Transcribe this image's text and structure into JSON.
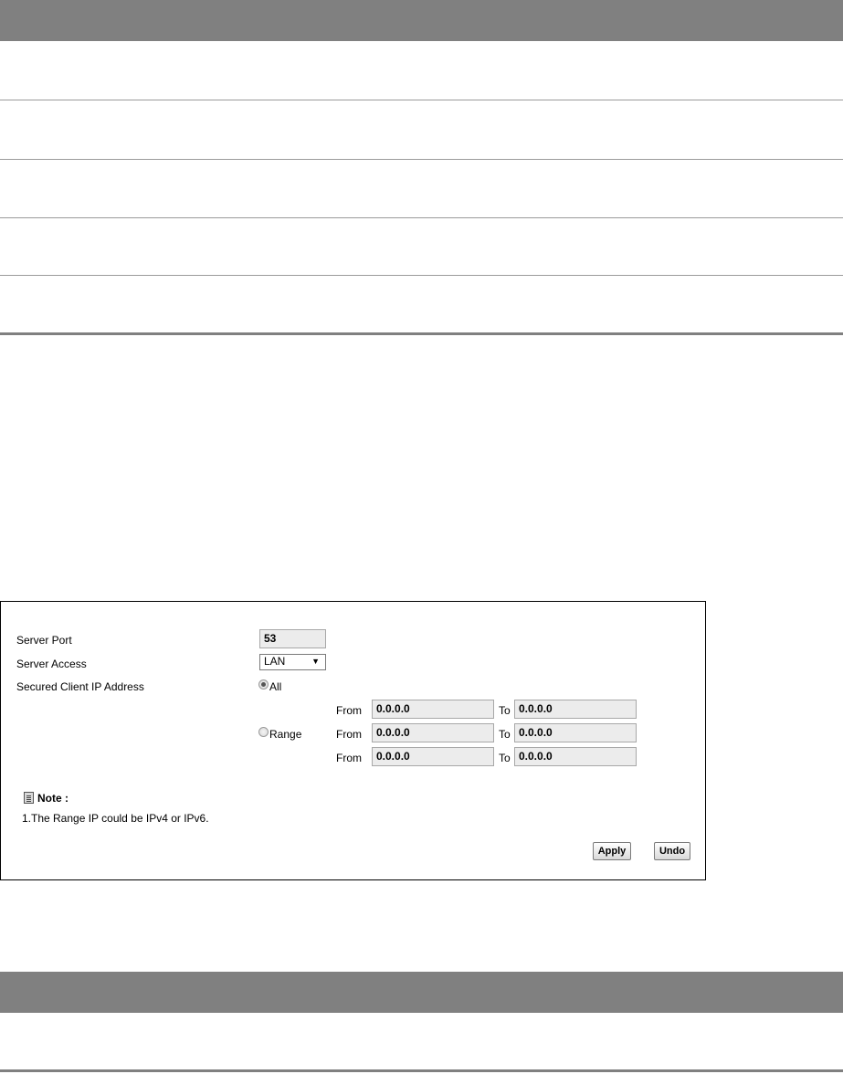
{
  "form": {
    "server_port": {
      "label": "Server Port",
      "value": "53"
    },
    "server_access": {
      "label": "Server Access",
      "selected": "LAN"
    },
    "secured_client": {
      "label": "Secured Client IP Address",
      "option_all": "All",
      "option_range": "Range",
      "selected": "All",
      "from_label": "From",
      "to_label": "To",
      "ranges": [
        {
          "from": "0.0.0.0",
          "to": "0.0.0.0"
        },
        {
          "from": "0.0.0.0",
          "to": "0.0.0.0"
        },
        {
          "from": "0.0.0.0",
          "to": "0.0.0.0"
        }
      ]
    },
    "note": {
      "title": "Note :",
      "lines": [
        "1.The Range IP could be IPv4 or IPv6."
      ]
    },
    "buttons": {
      "apply": "Apply",
      "undo": "Undo"
    }
  },
  "icons": {
    "note": "note-document-icon",
    "dropdown": "triangle-down-icon"
  },
  "colors": {
    "header_band": "#808080",
    "input_bg": "#ececec",
    "rule": "#9a9a9a"
  }
}
